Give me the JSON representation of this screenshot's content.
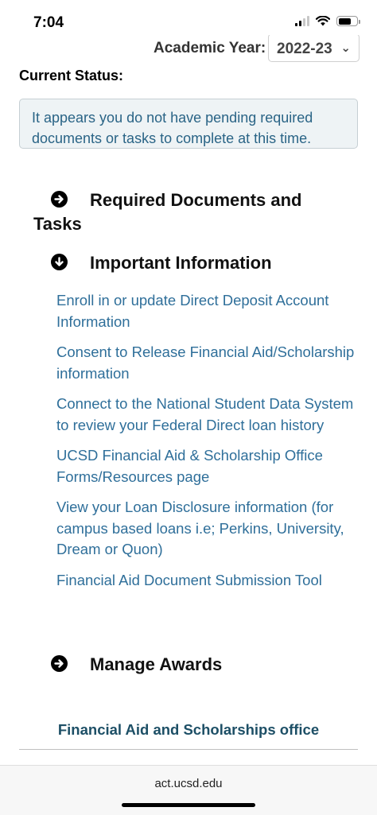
{
  "status_bar": {
    "time": "7:04"
  },
  "header": {
    "academic_year_label": "Academic Year:",
    "academic_year_value": "2022-23"
  },
  "current_status": {
    "label": "Current Status:",
    "message": "It appears you do not have pending required documents or tasks to complete at this time."
  },
  "sections": {
    "required_docs": {
      "label_line1": "Required Documents and",
      "label_line2": "Tasks",
      "icon": "arrow-right-circle-icon"
    },
    "important_info": {
      "label": "Important Information",
      "icon": "arrow-down-circle-icon"
    },
    "manage_awards": {
      "label": "Manage Awards",
      "icon": "arrow-right-circle-icon"
    }
  },
  "links": [
    "Enroll in or update Direct Deposit Account Information",
    "Consent to Release Financial Aid/Scholarship information",
    "Connect to the National Student Data System to review your Federal Direct loan history",
    "UCSD Financial Aid & Scholarship Office Forms/Resources page",
    "View your Loan Disclosure information (for campus based loans i.e; Perkins, University, Dream or Quon)",
    "Financial Aid Document Submission Tool"
  ],
  "footer": {
    "office_link": "Financial Aid and Scholarships office",
    "url": "act.ucsd.edu"
  },
  "colors": {
    "link": "#2f6f9a",
    "status_text": "#2a6486",
    "status_bg": "#eef3f5",
    "footer_link": "#1d4f66"
  }
}
